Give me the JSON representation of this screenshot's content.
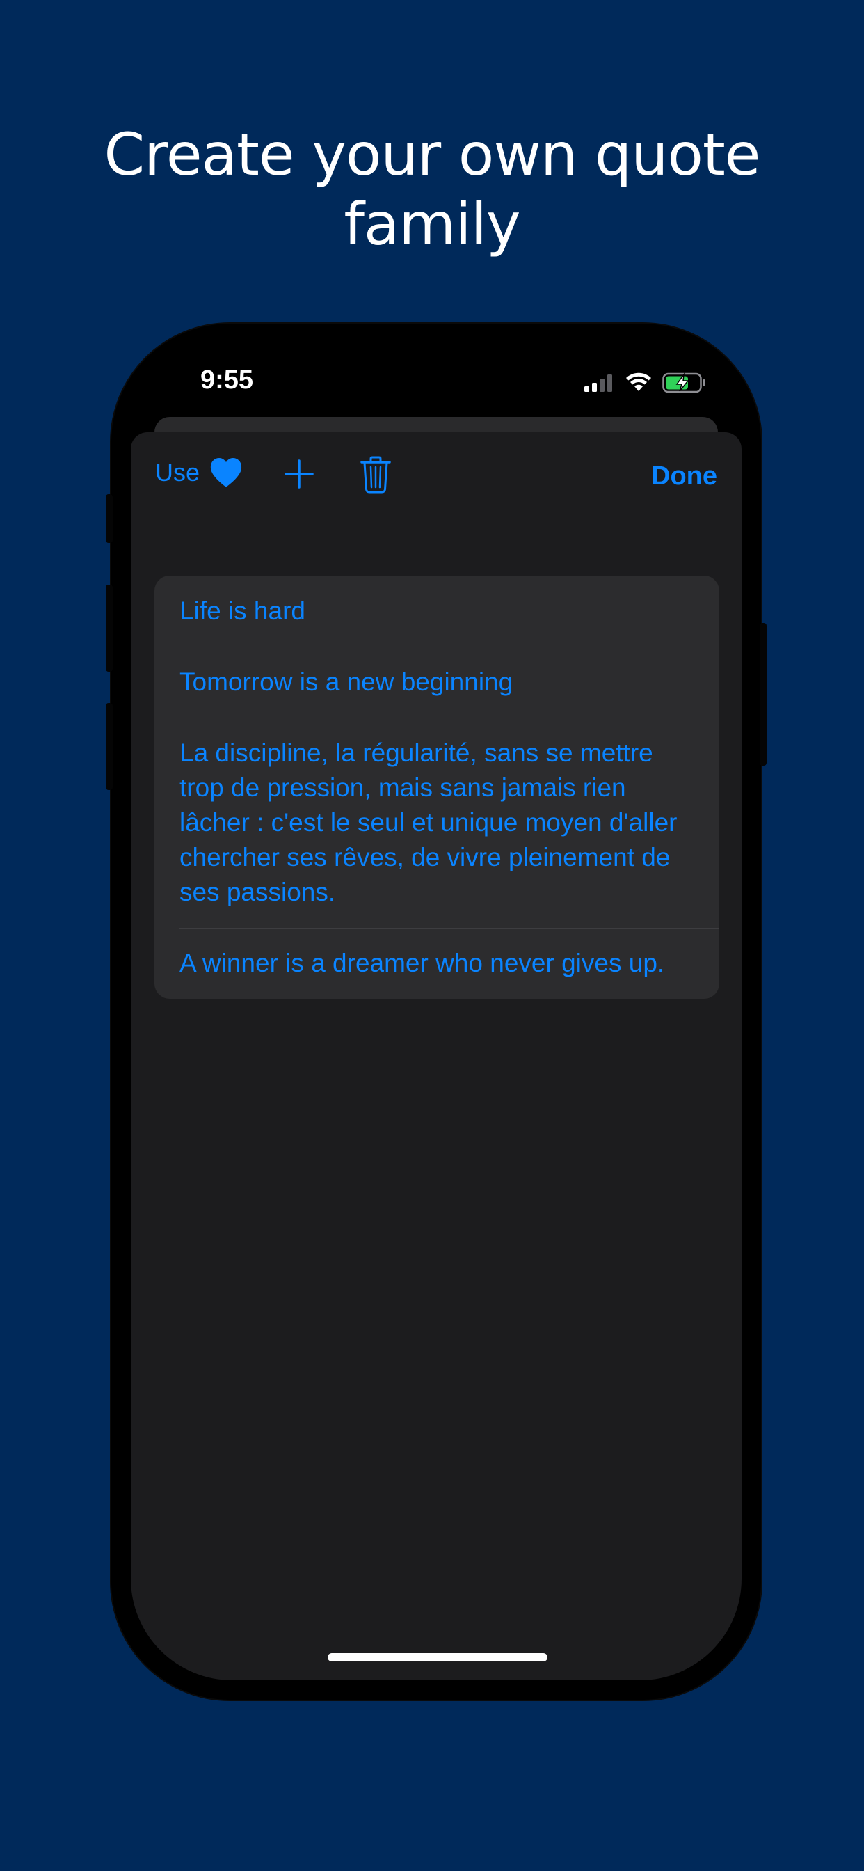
{
  "headline": {
    "line1": "Create your own quote",
    "line2": "family"
  },
  "status_bar": {
    "time": "9:55",
    "icons": [
      "signal-icon",
      "wifi-icon",
      "battery-charging-icon"
    ]
  },
  "toolbar": {
    "use_label": "Use",
    "use_icon": "heart-icon",
    "add_icon": "plus-icon",
    "delete_icon": "trash-icon",
    "done_label": "Done"
  },
  "quotes": [
    {
      "text": "Life is hard"
    },
    {
      "text": "Tomorrow is a new beginning"
    },
    {
      "text": "La discipline, la régularité, sans se mettre trop de pression, mais sans jamais rien lâcher : c'est le seul et unique moyen d'aller chercher ses rêves, de vivre pleinement de ses passions."
    },
    {
      "text": "A winner is a dreamer who never gives up."
    }
  ],
  "colors": {
    "background": "#00295a",
    "accent": "#0a84ff",
    "sheet": "#1c1c1e",
    "list": "#2c2c2e"
  }
}
